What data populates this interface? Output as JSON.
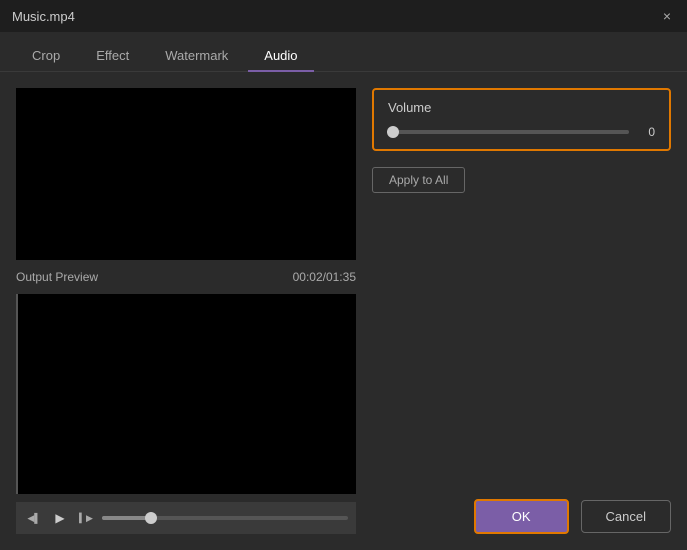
{
  "titlebar": {
    "title": "Music.mp4",
    "close_label": "×"
  },
  "tabs": [
    {
      "id": "crop",
      "label": "Crop",
      "active": false
    },
    {
      "id": "effect",
      "label": "Effect",
      "active": false
    },
    {
      "id": "watermark",
      "label": "Watermark",
      "active": false
    },
    {
      "id": "audio",
      "label": "Audio",
      "active": true
    }
  ],
  "output_preview": {
    "label": "Output Preview",
    "timestamp": "00:02/01:35"
  },
  "volume": {
    "title": "Volume",
    "value": "0",
    "slider_pct": 2
  },
  "buttons": {
    "apply_all": "Apply to All",
    "ok": "OK",
    "cancel": "Cancel"
  },
  "playback": {
    "prev_icon": "step-back-icon",
    "play_icon": "play-icon",
    "next_icon": "step-forward-icon"
  }
}
